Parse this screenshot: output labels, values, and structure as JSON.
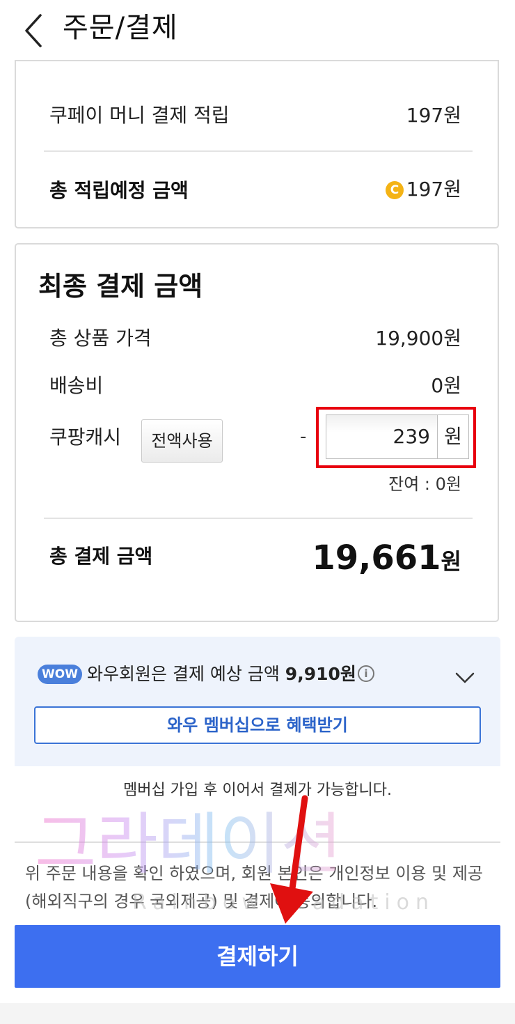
{
  "header": {
    "title": "주문/결제"
  },
  "rewards": {
    "coupay_label": "쿠페이 머니 결제 적립",
    "coupay_value": "197원",
    "total_label": "총 적립예정 금액",
    "coin_symbol": "C",
    "total_value": "197원"
  },
  "final": {
    "title": "최종 결제 금액",
    "product_label": "총 상품 가격",
    "product_value": "19,900원",
    "shipping_label": "배송비",
    "shipping_value": "0원",
    "cash_label": "쿠팡캐시",
    "use_all_label": "전액사용",
    "minus_sign": "-",
    "cash_input_value": "239",
    "cash_unit": "원",
    "balance_text": "잔여 : 0원",
    "total_label": "총 결제 금액",
    "total_amount": "19,661",
    "total_unit": "원"
  },
  "wow": {
    "badge": "WOW",
    "text_prefix": "와우회원은 결제 예상 금액 ",
    "text_amount": "9,910원",
    "info_symbol": "i",
    "membership_button": "와우 멤버십으로 혜택받기"
  },
  "notice": "멤버십 가입 후 이어서 결제가 가능합니다.",
  "agreement": "위 주문 내용을 확인 하였으며, 회원 본인은 개인정보 이용 및 제공(해외직구의 경우 국외제공) 및 결제에 동의합니다.",
  "watermark": {
    "main": "그라데이션",
    "sub": "Rainbow gradation"
  },
  "pay_button": "결제하기",
  "colors": {
    "primary_blue": "#3d6ff0",
    "highlight_red": "#e8000e",
    "wow_badge": "#4a7fdb",
    "coin": "#f4b315",
    "arrow_red": "#e01010"
  },
  "icons": [
    "back-arrow-icon",
    "coin-icon",
    "info-icon",
    "chevron-down-icon"
  ]
}
